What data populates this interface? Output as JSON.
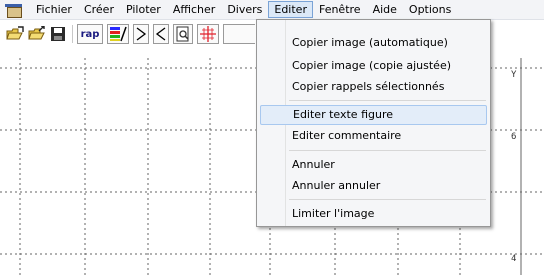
{
  "menubar": {
    "items": [
      "Fichier",
      "Créer",
      "Piloter",
      "Afficher",
      "Divers",
      "Editer",
      "Fenêtre",
      "Aide",
      "Options"
    ],
    "active": "Editer"
  },
  "toolbar": {
    "buttons": [
      "open-folder-icon",
      "open-folder-arrow-icon",
      "save-icon",
      "rap",
      "color-bars-icon",
      "zoom-next-icon",
      "zoom-prev-icon",
      "page-preview-icon",
      "crosshair-icon"
    ],
    "rap_label": "rap"
  },
  "graph": {
    "y_tick_labels": [
      "Y",
      "6",
      "4"
    ]
  },
  "dropdown": {
    "items": [
      {
        "label": "Copier image (automatique)"
      },
      {
        "label": "Copier image (copie ajustée)"
      },
      {
        "label": "Copier rappels sélectionnés"
      },
      {
        "label": "Editer texte figure",
        "highlighted": true
      },
      {
        "label": "Editer commentaire"
      },
      {
        "label": "Annuler"
      },
      {
        "label": "Annuler annuler"
      },
      {
        "label": "Limiter l'image"
      }
    ]
  },
  "colors": {
    "highlight": "#e3edf9",
    "menu_active": "#dbe8f7",
    "accent_red": "#e0202a"
  }
}
